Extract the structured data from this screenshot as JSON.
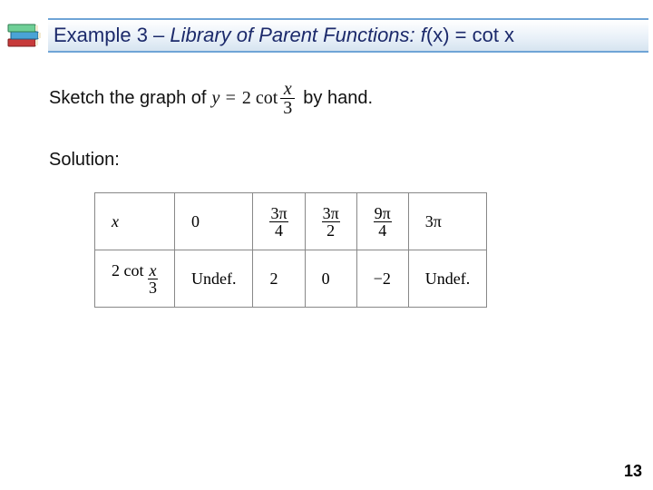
{
  "header": {
    "title_plain_prefix": "Example 3 – ",
    "title_italic": "Library of Parent Functions: f",
    "title_args": "(x) = cot x"
  },
  "instruction": {
    "before": "Sketch the graph of",
    "eq_prefix": "y =",
    "eq_coef": "2 cot",
    "eq_num": "x",
    "eq_den": "3",
    "after": "by hand."
  },
  "solution_label": "Solution:",
  "table": {
    "row1_label": "x",
    "row2_label_text": "2 cot",
    "row2_frac_num": "x",
    "row2_frac_den": "3",
    "cols": [
      {
        "x": {
          "type": "plain",
          "text": "0"
        },
        "y": "Undef."
      },
      {
        "x": {
          "type": "frac",
          "num": "3π",
          "den": "4"
        },
        "y": "2"
      },
      {
        "x": {
          "type": "frac",
          "num": "3π",
          "den": "2"
        },
        "y": "0"
      },
      {
        "x": {
          "type": "frac",
          "num": "9π",
          "den": "4"
        },
        "y": "−2"
      },
      {
        "x": {
          "type": "plain",
          "text": "3π"
        },
        "y": "Undef."
      }
    ]
  },
  "page_number": "13",
  "chart_data": {
    "type": "table",
    "title": "Values of y = 2 cot(x/3)",
    "columns": [
      "x",
      "2 cot(x/3)"
    ],
    "rows": [
      [
        "0",
        "Undef."
      ],
      [
        "3π/4",
        "2"
      ],
      [
        "3π/2",
        "0"
      ],
      [
        "9π/4",
        "−2"
      ],
      [
        "3π",
        "Undef."
      ]
    ]
  }
}
